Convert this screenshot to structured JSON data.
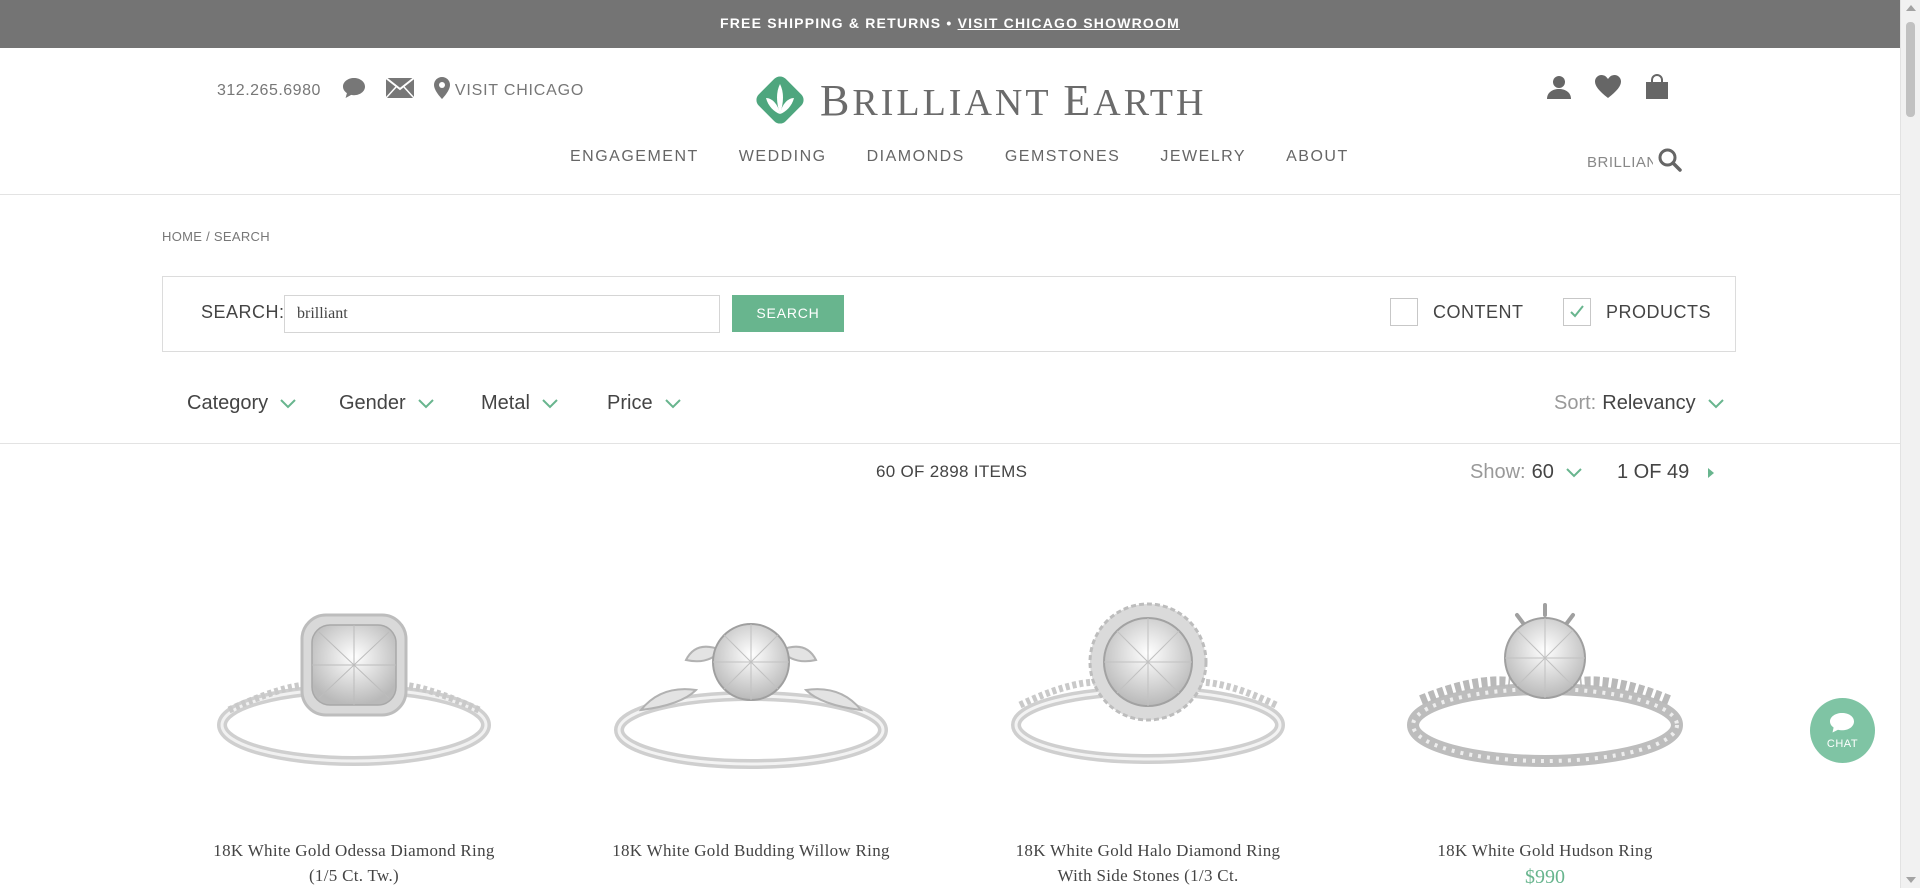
{
  "topbar": {
    "text": "FREE SHIPPING & RETURNS •",
    "link": "VISIT CHICAGO SHOWROOM"
  },
  "header": {
    "phone": "312.265.6980",
    "visit_label": "VISIT CHICAGO",
    "logo_name_part1": "B",
    "logo_name_part2": "RILLIANT ",
    "logo_name_part3": "E",
    "logo_name_part4": "ARTH",
    "search_value": "BRILLIANT",
    "nav": [
      "ENGAGEMENT",
      "WEDDING",
      "DIAMONDS",
      "GEMSTONES",
      "JEWELRY",
      "ABOUT"
    ]
  },
  "breadcrumb": "HOME / SEARCH",
  "search": {
    "label": "SEARCH:",
    "value": "brilliant",
    "button": "SEARCH",
    "content_label": "CONTENT",
    "products_label": "PRODUCTS",
    "content_checked": false,
    "products_checked": true
  },
  "filters": {
    "items": [
      "Category",
      "Gender",
      "Metal",
      "Price"
    ],
    "sort_label": "Sort:",
    "sort_value": "Relevancy"
  },
  "results": {
    "count": "60 OF 2898  ITEMS",
    "show_label": "Show:",
    "show_value": "60",
    "page": "1 OF 49"
  },
  "products": [
    {
      "title": "18K White Gold Odessa Diamond Ring (1/5 Ct. Tw.)",
      "price": ""
    },
    {
      "title": "18K White Gold Budding Willow Ring",
      "price": ""
    },
    {
      "title": "18K White Gold Halo Diamond Ring With Side Stones (1/3 Ct.",
      "price": ""
    },
    {
      "title": "18K White Gold Hudson Ring",
      "price": "$990"
    }
  ],
  "chat": {
    "label": "CHAT"
  },
  "colors": {
    "accent": "#68b58e",
    "topbar": "#747474",
    "text": "#444444"
  }
}
